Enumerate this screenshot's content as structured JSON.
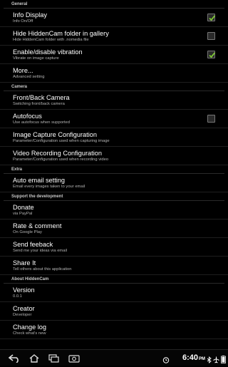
{
  "sections": [
    {
      "header": "General",
      "items": [
        {
          "title": "Info Display",
          "summary": "Info On/Off",
          "checkbox": true,
          "checked": true
        },
        {
          "title": "Hide HiddenCam folder in gallery",
          "summary": "Hide HiddenCam folder with .nomedia file",
          "checkbox": true,
          "checked": false
        },
        {
          "title": "Enable/disable vibration",
          "summary": "Vibrate on image capture",
          "checkbox": true,
          "checked": true
        },
        {
          "title": "More...",
          "summary": "Advanced setting",
          "checkbox": false
        }
      ]
    },
    {
      "header": "Camera",
      "items": [
        {
          "title": "Front/Back Camera",
          "summary": "Switching front/back camera",
          "checkbox": false
        },
        {
          "title": "Autofocus",
          "summary": "Use autofocus when supported",
          "checkbox": true,
          "checked": false
        },
        {
          "title": "Image Capture Configuration",
          "summary": "Parameter/Configuration used when capturing image",
          "checkbox": false
        },
        {
          "title": "Video Recording Configuration",
          "summary": "Parameter/Configuration used when recording video",
          "checkbox": false
        }
      ]
    },
    {
      "header": "Extra",
      "items": [
        {
          "title": "Auto email setting",
          "summary": "Email every images taken to your email",
          "checkbox": false
        }
      ]
    },
    {
      "header": "Support the development",
      "items": [
        {
          "title": "Donate",
          "summary": "via PayPal",
          "checkbox": false
        },
        {
          "title": "Rate & comment",
          "summary": "On Google Play",
          "checkbox": false
        },
        {
          "title": "Send feeback",
          "summary": "Send me your ideas via email",
          "checkbox": false
        },
        {
          "title": "Share It",
          "summary": "Tell others about this application",
          "checkbox": false
        }
      ]
    },
    {
      "header": "About HiddenCam",
      "items": [
        {
          "title": "Version",
          "summary": "0.0.1",
          "checkbox": false
        },
        {
          "title": "Creator",
          "summary": "Developer",
          "checkbox": false
        },
        {
          "title": "Change log",
          "summary": "Check what's new",
          "checkbox": false
        }
      ]
    }
  ],
  "status_bar": {
    "clock": "6:40",
    "clock_suffix": "PM",
    "icons": [
      "back-icon",
      "home-icon",
      "recent-apps-icon",
      "screenshot-icon",
      "alarm-icon",
      "bluetooth-icon",
      "airplane-mode-icon",
      "battery-icon"
    ]
  },
  "colors": {
    "background": "#000000",
    "checkbox_check": "#7ec636",
    "section_text": "#c8c8c8",
    "summary_text": "#b4b4b4"
  }
}
